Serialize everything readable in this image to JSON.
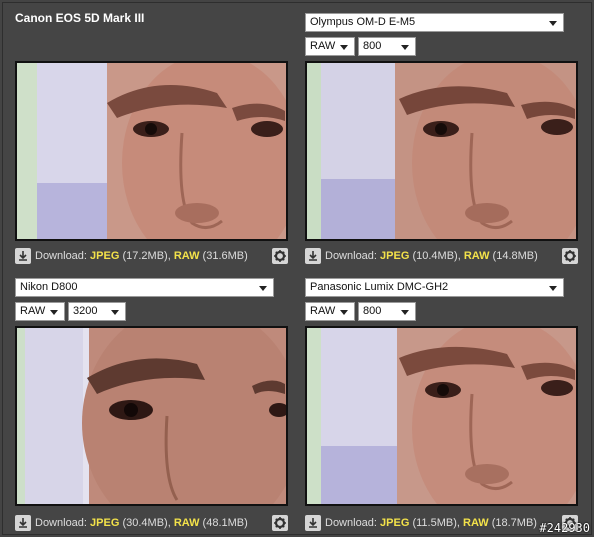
{
  "panels": [
    {
      "camera": "Canon EOS 5D Mark III",
      "download": {
        "prefix": "Download: ",
        "jpeg": "JPEG",
        "jpeg_size": " (17.2MB), ",
        "raw": "RAW",
        "raw_size": " (31.6MB)"
      }
    },
    {
      "camera": "Olympus OM-D E-M5",
      "format": "RAW",
      "iso": "800",
      "download": {
        "prefix": "Download: ",
        "jpeg": "JPEG",
        "jpeg_size": " (10.4MB), ",
        "raw": "RAW",
        "raw_size": " (14.8MB)"
      }
    },
    {
      "camera": "Nikon D800",
      "format": "RAW",
      "iso": "3200",
      "download": {
        "prefix": "Download: ",
        "jpeg": "JPEG",
        "jpeg_size": " (30.4MB), ",
        "raw": "RAW",
        "raw_size": " (48.1MB)"
      }
    },
    {
      "camera": "Panasonic Lumix DMC-GH2",
      "format": "RAW",
      "iso": "800",
      "download": {
        "prefix": "Download: ",
        "jpeg": "JPEG",
        "jpeg_size": " (11.5MB), ",
        "raw": "RAW",
        "raw_size": " (18.7MB)"
      }
    }
  ],
  "watermark": "#242930",
  "icons": {
    "download": "download-arrow-icon",
    "settings": "gear-icon"
  },
  "colors": {
    "background": "#454545",
    "format_highlight": "#f3e24a"
  }
}
